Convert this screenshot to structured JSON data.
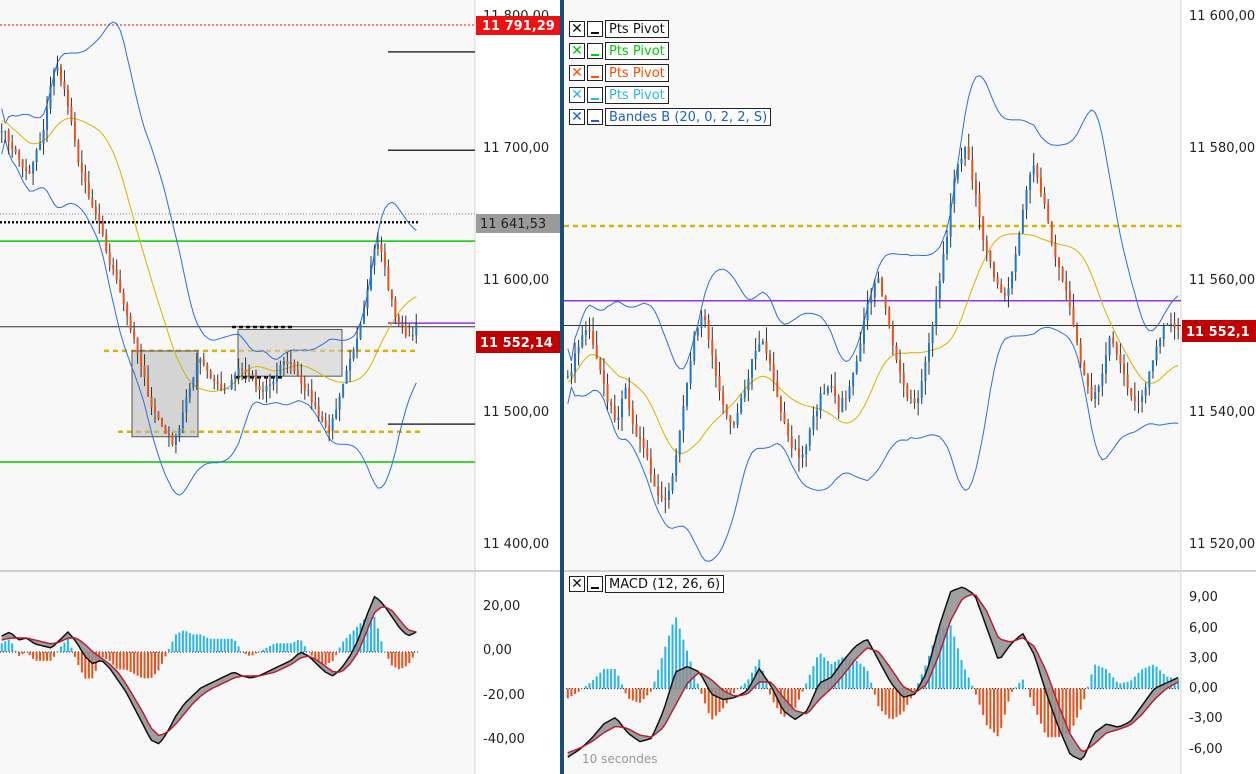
{
  "colors": {
    "up": "#1f78c8",
    "down": "#e8521c",
    "band": "#2f6fd6",
    "mid": "#d8b400",
    "pivot_green": "#00cc00",
    "pivot_gold": "#d8b400",
    "purple": "#9933dd",
    "macd": "#111111",
    "signal": "#e01010",
    "hist_pos": "#29b6e6",
    "hist_neg": "#e8521c",
    "tag_red": "#ee1111",
    "tag_darkred": "#c00000",
    "tag_gray": "#9a9a9a",
    "divider": "#1b4f73"
  },
  "left_panel": {
    "price_axis": {
      "ticks": [
        "11 800,00",
        "11 700,00",
        "11 600,00",
        "11 500,00",
        "11 400,00"
      ]
    },
    "tags": {
      "top": "11 791,29",
      "mid": "11 641,53",
      "last": "11 552,14"
    },
    "macd_axis": {
      "ticks": [
        "20,00",
        "0,00",
        "-20,00",
        "-40,00"
      ]
    }
  },
  "right_panel": {
    "price_axis": {
      "ticks": [
        "11 600,00",
        "11 580,00",
        "11 560,00",
        "11 540,00",
        "11 520,00"
      ]
    },
    "tags": {
      "last": "11 552,1"
    },
    "macd_axis": {
      "ticks": [
        "9,00",
        "6,00",
        "3,00",
        "0,00",
        "-3,00",
        "-6,00"
      ]
    },
    "legend": [
      {
        "label": "Pts Pivot",
        "color": "#111111"
      },
      {
        "label": "Pts Pivot",
        "color": "#00cc00"
      },
      {
        "label": "Pts Pivot",
        "color": "#ff4a00"
      },
      {
        "label": "Pts Pivot",
        "color": "#29b6e6"
      },
      {
        "label": "Bandes B (20, 0, 2, 2, S)",
        "color": "#1a5fd0"
      }
    ],
    "macd_legend": {
      "label": "MACD (12, 26, 6)"
    },
    "interval_label": "10 secondes"
  },
  "chart_data": [
    {
      "type": "candlestick",
      "panel": "left-price",
      "ylim": [
        11380,
        11800
      ],
      "yticks": [
        11800,
        11700,
        11600,
        11500,
        11400
      ],
      "last_price": 11552.14,
      "price_tags": [
        11791.29,
        11641.53,
        11552.14
      ],
      "pivot_lines": [
        11791.29,
        11641.53,
        11620,
        11445,
        11552.14
      ],
      "close_trend": [
        11710,
        11700,
        11690,
        11680,
        11670,
        11690,
        11700,
        11740,
        11760,
        11745,
        11720,
        11690,
        11670,
        11650,
        11640,
        11620,
        11600,
        11590,
        11570,
        11550,
        11530,
        11510,
        11490,
        11480,
        11470,
        11460,
        11470,
        11490,
        11510,
        11530,
        11520,
        11510,
        11505,
        11500,
        11510,
        11520,
        11515,
        11510,
        11500,
        11505,
        11510,
        11520,
        11525,
        11520,
        11510,
        11500,
        11490,
        11480,
        11470,
        11480,
        11500,
        11520,
        11540,
        11560,
        11590,
        11620,
        11610,
        11580,
        11560,
        11550,
        11545,
        11552
      ]
    },
    {
      "type": "macd",
      "panel": "left-macd",
      "ylim": [
        -55,
        35
      ],
      "yticks": [
        20,
        0,
        -20,
        -40
      ],
      "macd": [
        8,
        10,
        6,
        7,
        4,
        3,
        2,
        6,
        10,
        5,
        -2,
        -6,
        -4,
        -8,
        -14,
        -20,
        -28,
        -36,
        -44,
        -46,
        -40,
        -32,
        -26,
        -22,
        -18,
        -16,
        -14,
        -12,
        -10,
        -12,
        -13,
        -12,
        -10,
        -8,
        -6,
        -4,
        0,
        -2,
        -6,
        -10,
        -12,
        -8,
        -2,
        6,
        18,
        28,
        24,
        18,
        12,
        8,
        10
      ],
      "signal": [
        6,
        7,
        7,
        7,
        6,
        5,
        4,
        5,
        7,
        7,
        4,
        0,
        -3,
        -6,
        -10,
        -16,
        -23,
        -30,
        -38,
        -42,
        -40,
        -36,
        -31,
        -26,
        -22,
        -19,
        -17,
        -15,
        -13,
        -12,
        -12,
        -12,
        -11,
        -10,
        -8,
        -6,
        -3,
        -2,
        -4,
        -7,
        -10,
        -10,
        -6,
        0,
        10,
        20,
        23,
        21,
        16,
        11,
        10
      ]
    },
    {
      "type": "candlestick",
      "panel": "right-price",
      "ylim": [
        11515,
        11605
      ],
      "yticks": [
        11600,
        11580,
        11560,
        11540,
        11520
      ],
      "last_price": 11552.1,
      "price_tags": [
        11552.1
      ],
      "pivot_lines": [
        11568.5,
        11556.5,
        11552.1
      ],
      "close_trend": [
        11543,
        11548,
        11552,
        11546,
        11540,
        11536,
        11541,
        11534,
        11530,
        11525,
        11522,
        11528,
        11540,
        11550,
        11554,
        11546,
        11538,
        11534,
        11540,
        11546,
        11550,
        11545,
        11538,
        11532,
        11530,
        11534,
        11540,
        11542,
        11538,
        11541,
        11548,
        11556,
        11560,
        11554,
        11545,
        11540,
        11538,
        11546,
        11556,
        11566,
        11578,
        11582,
        11576,
        11566,
        11560,
        11556,
        11562,
        11572,
        11580,
        11574,
        11566,
        11560,
        11554,
        11545,
        11540,
        11543,
        11550,
        11546,
        11541,
        11539,
        11544,
        11550,
        11553,
        11552
      ]
    },
    {
      "type": "macd",
      "panel": "right-macd",
      "ylim": [
        -7,
        10
      ],
      "yticks": [
        9,
        6,
        3,
        0,
        -3,
        -6
      ],
      "macd": [
        -6.2,
        -5.5,
        -4.5,
        -3.2,
        -2.6,
        -4.0,
        -4.8,
        -4.5,
        -2.0,
        1.5,
        2.0,
        1.5,
        -0.5,
        -1.0,
        -0.8,
        -0.2,
        1.8,
        0.2,
        -2.0,
        -2.8,
        -2.0,
        0.5,
        1.0,
        2.5,
        3.8,
        4.5,
        2.5,
        0.5,
        -0.8,
        -0.5,
        1.5,
        5.5,
        8.8,
        9.2,
        8.5,
        5.5,
        2.5,
        4.0,
        5.0,
        3.0,
        -0.5,
        -3.5,
        -6.0,
        -6.5,
        -4.0,
        -3.2,
        -3.5,
        -3.0,
        -1.5,
        0.0,
        0.5,
        1.0
      ],
      "signal": [
        -5.8,
        -5.4,
        -4.8,
        -4.0,
        -3.4,
        -3.6,
        -4.2,
        -4.4,
        -3.5,
        -1.5,
        0.5,
        1.5,
        0.8,
        -0.2,
        -0.7,
        -0.5,
        0.6,
        0.6,
        -0.8,
        -2.0,
        -2.3,
        -1.0,
        0.0,
        1.2,
        2.6,
        3.7,
        3.3,
        1.8,
        0.2,
        -0.4,
        0.4,
        3.0,
        6.2,
        8.2,
        8.6,
        7.0,
        4.5,
        4.2,
        4.6,
        3.8,
        1.5,
        -1.5,
        -4.2,
        -5.8,
        -5.0,
        -4.0,
        -3.7,
        -3.3,
        -2.3,
        -1.0,
        0.0,
        0.6
      ]
    }
  ]
}
